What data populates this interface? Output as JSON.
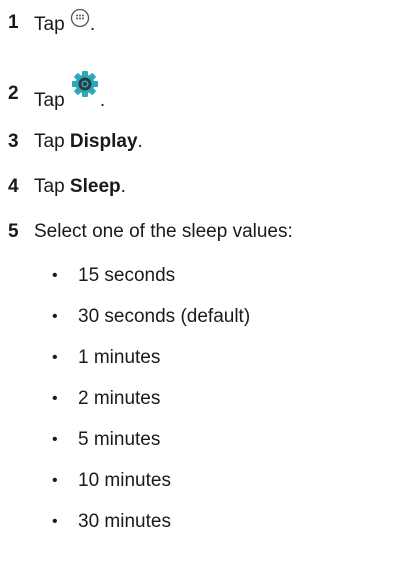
{
  "steps": [
    {
      "number": "1",
      "prefix": "Tap ",
      "icon": "apps-grid-icon",
      "suffix": "."
    },
    {
      "number": "2",
      "prefix": "Tap ",
      "icon": "settings-gear-icon",
      "suffix": "."
    },
    {
      "number": "3",
      "prefix": "Tap ",
      "bold": "Display",
      "suffix": "."
    },
    {
      "number": "4",
      "prefix": "Tap ",
      "bold": "Sleep",
      "suffix": "."
    },
    {
      "number": "5",
      "text": "Select one of the sleep values:"
    }
  ],
  "sleep_values": [
    "15 seconds",
    "30 seconds (default)",
    "1 minutes",
    "2 minutes",
    "5 minutes",
    "10 minutes",
    "30 minutes"
  ],
  "bullet_char": "•",
  "colors": {
    "text": "#1a1a1a",
    "gear_teal": "#2aa9b8",
    "gear_dark": "#2b3a42",
    "apps_icon_stroke": "#555555"
  }
}
